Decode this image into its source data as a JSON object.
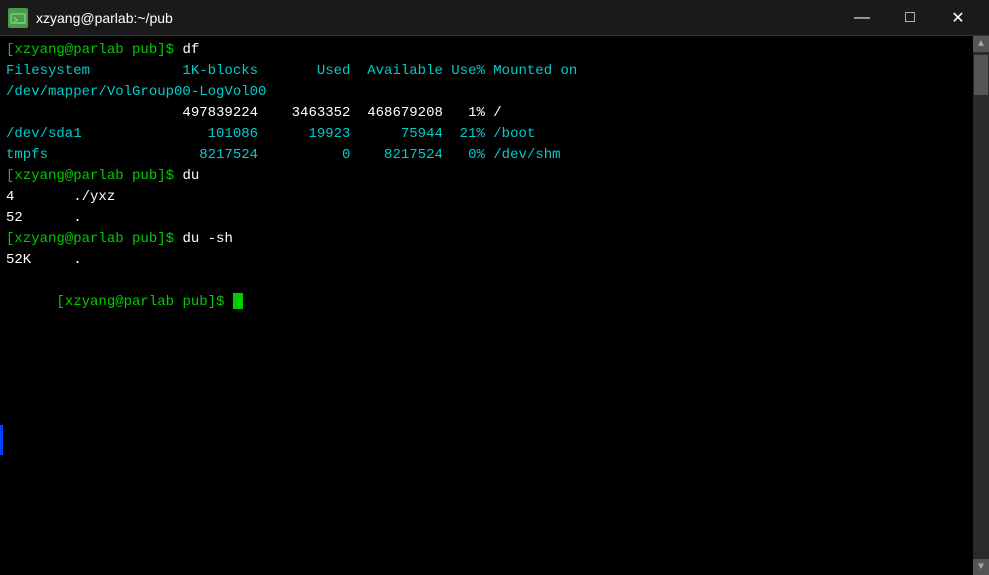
{
  "titlebar": {
    "title": "xzyang@parlab:~/pub",
    "icon_label": "T",
    "minimize_label": "—",
    "maximize_label": "□",
    "close_label": "✕"
  },
  "terminal": {
    "lines": [
      {
        "type": "prompt",
        "content": "[xzyang@parlab pub]$ df"
      },
      {
        "type": "header",
        "content": "Filesystem           1K-blocks       Used  Available Use% Mounted on"
      },
      {
        "type": "fs",
        "content": "/dev/mapper/VolGroup00-LogVol00"
      },
      {
        "type": "numbers",
        "content": "                     497839224    3463352  468679208   1% /"
      },
      {
        "type": "fs",
        "content": "/dev/sda1"
      },
      {
        "type": "numbers",
        "content": "                        101086      19923      75944  21% /boot"
      },
      {
        "type": "fs",
        "content": "tmpfs"
      },
      {
        "type": "numbers",
        "content": "                       8217524          0    8217524   0% /dev/shm"
      },
      {
        "type": "prompt",
        "content": "[xzyang@parlab pub]$ du"
      },
      {
        "type": "numbers",
        "content": "4       ./yxz"
      },
      {
        "type": "numbers",
        "content": "52      ."
      },
      {
        "type": "prompt",
        "content": "[xzyang@parlab pub]$ du -sh"
      },
      {
        "type": "numbers",
        "content": "52K     ."
      },
      {
        "type": "prompt_cursor",
        "content": "[xzyang@parlab pub]$ "
      }
    ]
  }
}
